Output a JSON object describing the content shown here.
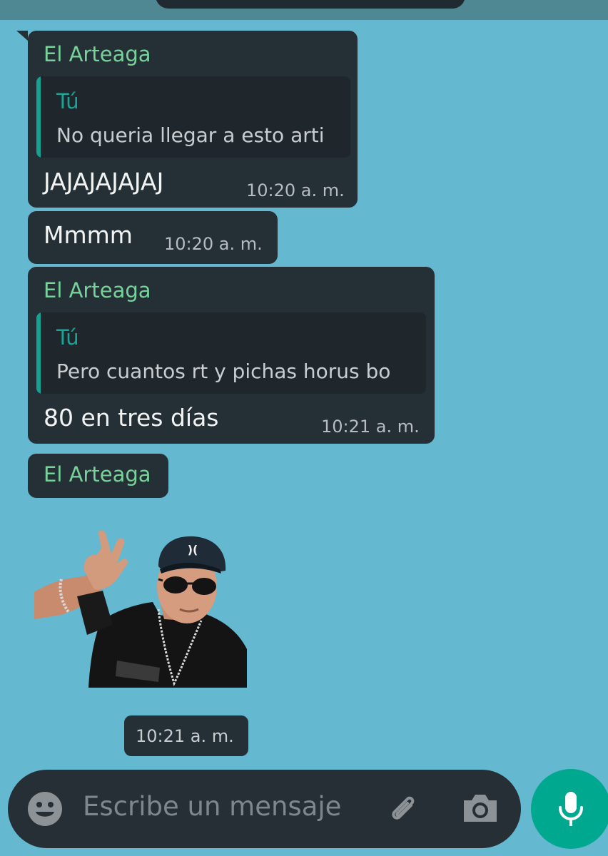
{
  "messages": [
    {
      "sender": "El Arteaga",
      "quote": {
        "author": "Tú",
        "text": "No queria llegar a esto arti"
      },
      "text": "JAJAJAJAJAJ",
      "time": "10:20 a. m."
    },
    {
      "text": "Mmmm",
      "time": "10:20 a. m."
    },
    {
      "sender": "El Arteaga",
      "quote": {
        "author": "Tú",
        "text": "Pero cuantos rt y pichas horus bo"
      },
      "text": "80 en tres días",
      "time": "10:21 a. m."
    },
    {
      "sender": "El Arteaga",
      "sticker": "photo-sticker-man-cap-sunglasses",
      "time": "10:21 a. m."
    }
  ],
  "input": {
    "placeholder": "Escribe un mensaje",
    "emoji_icon": "emoji-icon",
    "attach_icon": "paperclip-icon",
    "camera_icon": "camera-icon",
    "mic_icon": "microphone-icon"
  },
  "colors": {
    "chat_background": "#64b8d0",
    "bubble": "#252f36",
    "sender_name": "#77d39a",
    "quote_accent": "#13a391",
    "send_button": "#00a88f"
  }
}
